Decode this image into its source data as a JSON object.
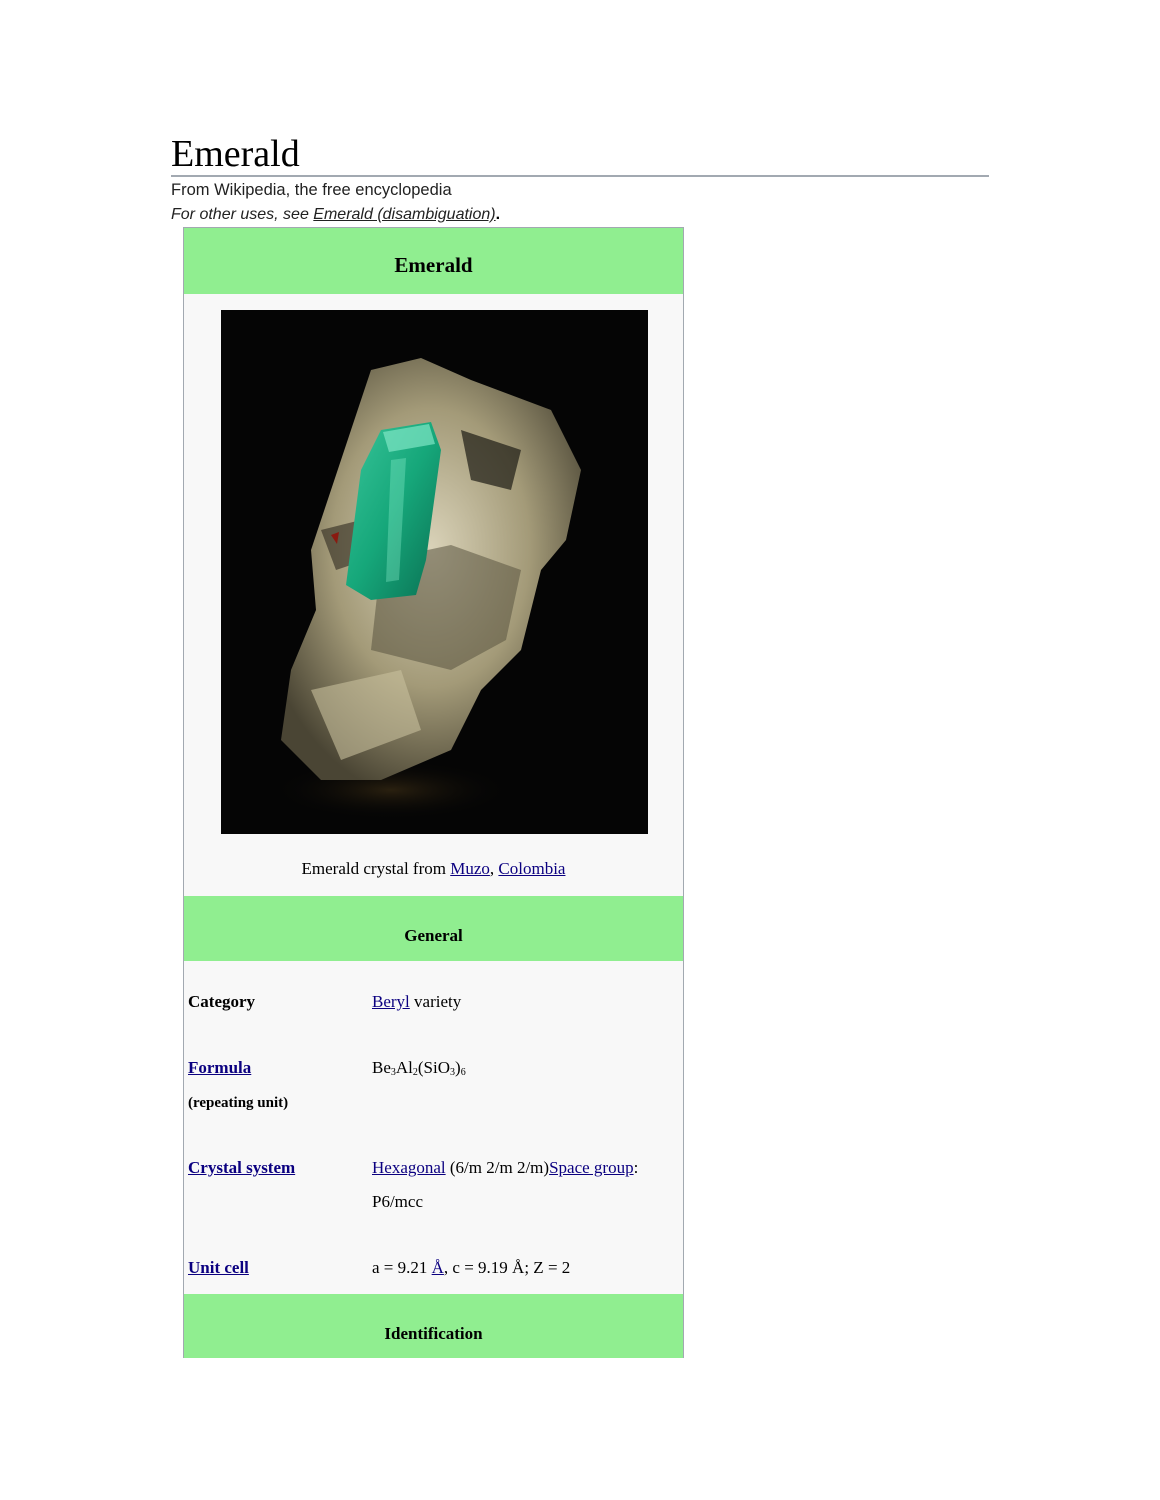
{
  "page": {
    "title": "Emerald",
    "tagline": "From Wikipedia, the free encyclopedia",
    "hatnote": {
      "prefix": "For other uses, see ",
      "link": "Emerald (disambiguation)",
      "suffix": "."
    }
  },
  "infobox": {
    "title": "Emerald",
    "caption": {
      "prefix": "Emerald crystal from ",
      "link1": "Muzo",
      "sep": ", ",
      "link2": "Colombia"
    },
    "sections": {
      "general": "General",
      "identification": "Identification"
    },
    "rows": {
      "category": {
        "label": "Category",
        "value_link": "Beryl",
        "value_text": " variety"
      },
      "formula": {
        "label": "Formula",
        "sublabel": "(repeating unit)",
        "parts": [
          "Be",
          "3",
          "Al",
          "2",
          "(SiO",
          "3",
          ")",
          "6"
        ]
      },
      "crystal_system": {
        "label": "Crystal system",
        "link1": "Hexagonal",
        "text1": " (6/m 2/m 2/m)",
        "link2": "Space group",
        "text2": ":",
        "line2": "P6/mcc"
      },
      "unit_cell": {
        "label": "Unit cell",
        "text1": "a = 9.21 ",
        "link": "Å",
        "text2": ", c = 9.19 Å; Z = 2"
      }
    }
  },
  "colors": {
    "header_green": "#90ee90",
    "link": "#0b0080",
    "infobox_bg": "#f8f8f8"
  }
}
